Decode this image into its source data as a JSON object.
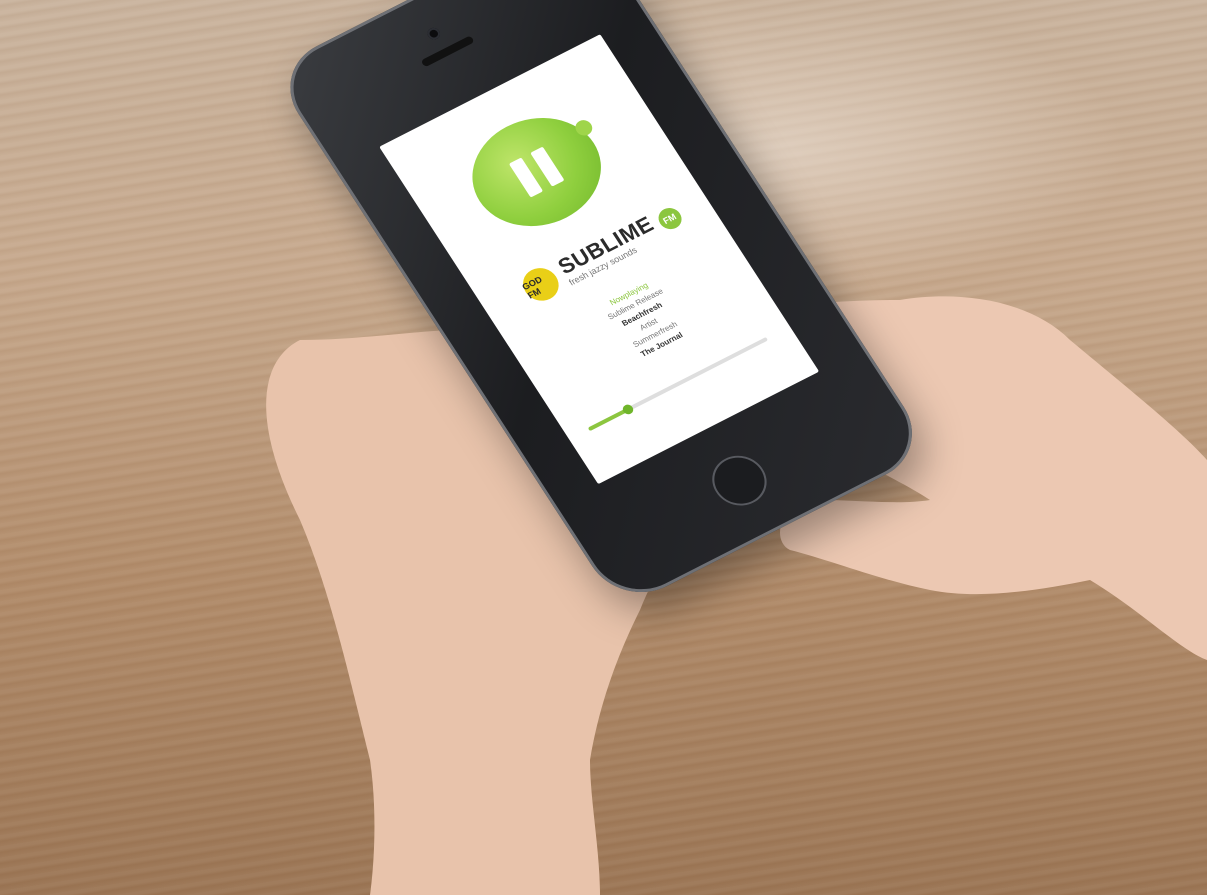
{
  "app": {
    "brand": {
      "name": "SUBLIME",
      "tagline": "fresh jazzy sounds",
      "station_badge": "GOD FM",
      "fm_badge": "FM"
    },
    "now_playing": {
      "label": "Nowplaying",
      "lines": [
        "Sublime Release",
        "Beachfresh",
        "Artist",
        "Summerfresh",
        "The Journal"
      ]
    },
    "progress": 0.22,
    "colors": {
      "accent": "#8cc63f",
      "badge": "#e9cf17"
    },
    "icons": {
      "play_pause": "pause-icon"
    }
  }
}
